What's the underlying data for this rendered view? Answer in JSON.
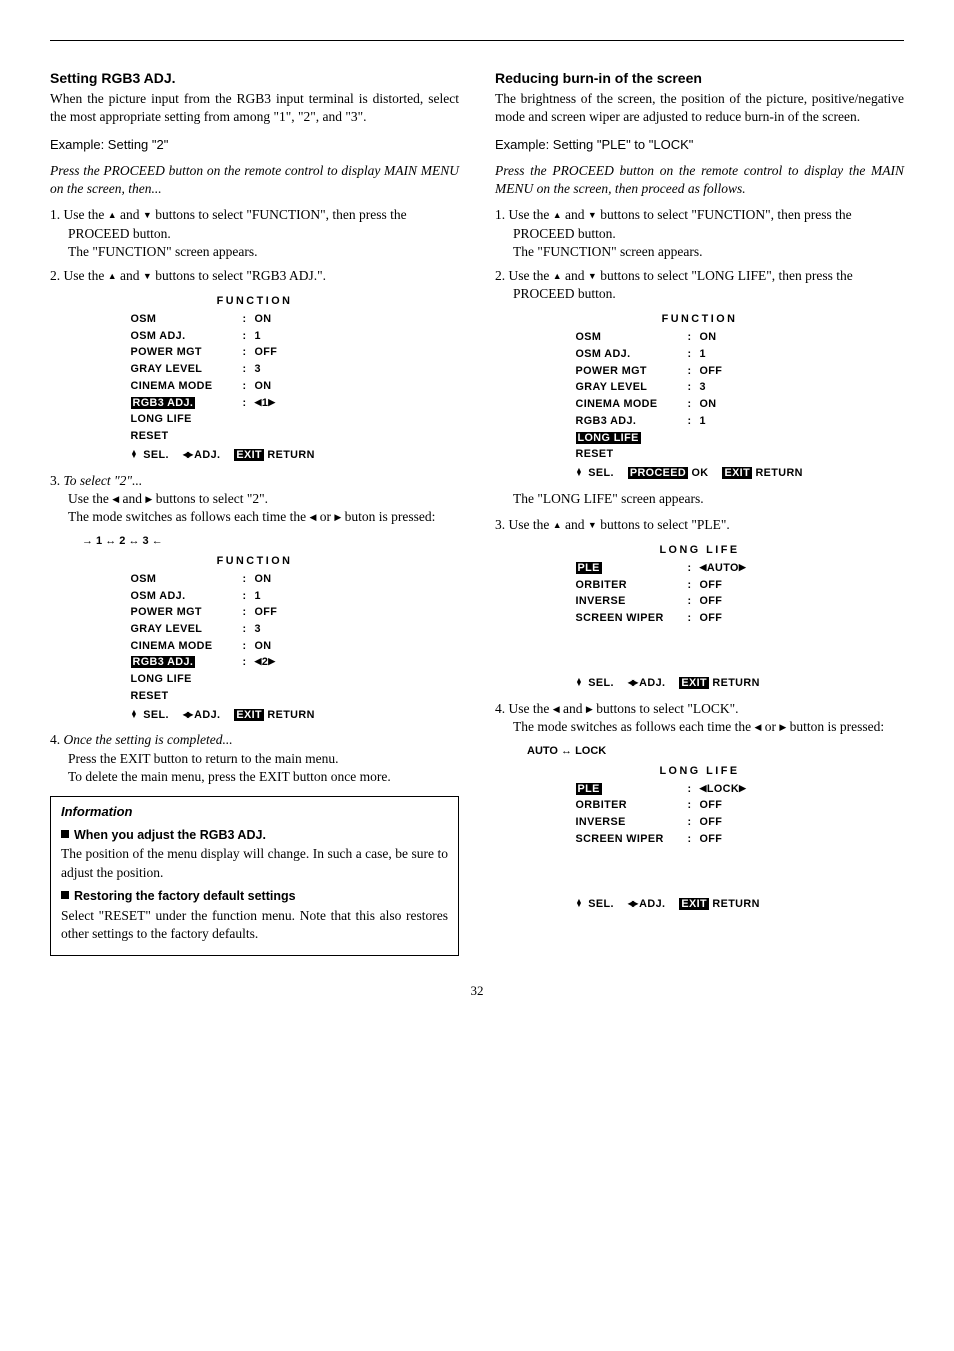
{
  "left": {
    "heading": "Setting RGB3 ADJ.",
    "intro": "When the picture input from the RGB3 input terminal is distorted, select the most appropriate setting from among \"1\", \"2\", and \"3\".",
    "example": "Example: Setting \"2\"",
    "press": "Press the PROCEED button on the remote control to display MAIN MENU on the screen, then...",
    "s1a": "1. Use the ",
    "s1b": " and ",
    "s1c": " buttons to select \"FUNCTION\", then press the PROCEED button.",
    "s1d": "The \"FUNCTION\" screen appears.",
    "s2a": "2. Use the ",
    "s2b": " and ",
    "s2c": " buttons to select \"RGB3 ADJ.\".",
    "s3a": "3. ",
    "s3b": "To select \"2\"...",
    "s3c": "Use the ",
    "s3d": " and ",
    "s3e": " buttons to select \"2\".",
    "s3f": "The mode switches as follows each time the ",
    "s3g": " or ",
    "s3h": " buton is pressed:",
    "nav": "→ 1 ↔ 2 ↔ 3 ←",
    "s4a": "4. ",
    "s4b": "Once the setting is completed...",
    "s4c": "Press the EXIT button to return to the main menu.",
    "s4d": "To delete the main menu, press the EXIT button once more.",
    "info_title": "Information",
    "info_h1": "When you adjust the RGB3 ADJ.",
    "info_p1": "The position of the menu display will change. In such a case, be sure to adjust the position.",
    "info_h2": "Restoring the factory default settings",
    "info_p2": "Select \"RESET\" under the function menu. Note that this also restores other settings to the factory defaults."
  },
  "right": {
    "heading": "Reducing burn-in of the screen",
    "intro": "The brightness of the screen, the position of the picture, positive/negative mode and screen wiper are adjusted to reduce burn-in of the screen.",
    "example": "Example: Setting \"PLE\" to \"LOCK\"",
    "press": "Press the PROCEED button on the remote control to display the MAIN MENU on the screen, then proceed as follows.",
    "s1a": "1. Use the ",
    "s1b": " and ",
    "s1c": " buttons to select \"FUNCTION\", then press the PROCEED button.",
    "s1d": "The \"FUNCTION\" screen appears.",
    "s2a": "2. Use the ",
    "s2b": " and ",
    "s2c": " buttons to select \"LONG LIFE\", then press the PROCEED button.",
    "s2d": "The \"LONG LIFE\" screen appears.",
    "s3a": "3. Use the ",
    "s3b": " and ",
    "s3c": " buttons to select \"PLE\".",
    "s4a": "4. Use the ",
    "s4b": " and ",
    "s4c": " buttons to select \"LOCK\".",
    "s4d": "The mode switches as follows each time the ",
    "s4e": " or ",
    "s4f": " button is pressed:",
    "nav": "AUTO ↔ LOCK"
  },
  "osd_func_title": "FUNCTION",
  "osd_life_title": "LONG LIFE",
  "osd_rows_func": {
    "osm_k": "OSM",
    "osm_v": "ON",
    "osmadj_k": "OSM ADJ.",
    "osmadj_v": "1",
    "pmgt_k": "POWER MGT",
    "pmgt_v": "OFF",
    "gray_k": "GRAY LEVEL",
    "gray_v": "3",
    "cinema_k": "CINEMA MODE",
    "cinema_v": "ON",
    "rgb3_k": "RGB3 ADJ.",
    "rgb3_v1": "1",
    "rgb3_v2": "2",
    "long_k": "LONG LIFE",
    "reset_k": "RESET"
  },
  "osd_rows_life": {
    "ple_k": "PLE",
    "ple_auto": "AUTO",
    "ple_lock": "LOCK",
    "orb_k": "ORBITER",
    "orb_v": "OFF",
    "inv_k": "INVERSE",
    "inv_v": "OFF",
    "wiper_k": "SCREEN WIPER",
    "wiper_v": "OFF"
  },
  "osd_foot": {
    "sel": "SEL.",
    "adj": "ADJ.",
    "ok": "OK",
    "proceed": "PROCEED",
    "exit": "EXIT",
    "return": "RETURN"
  },
  "page": "32"
}
